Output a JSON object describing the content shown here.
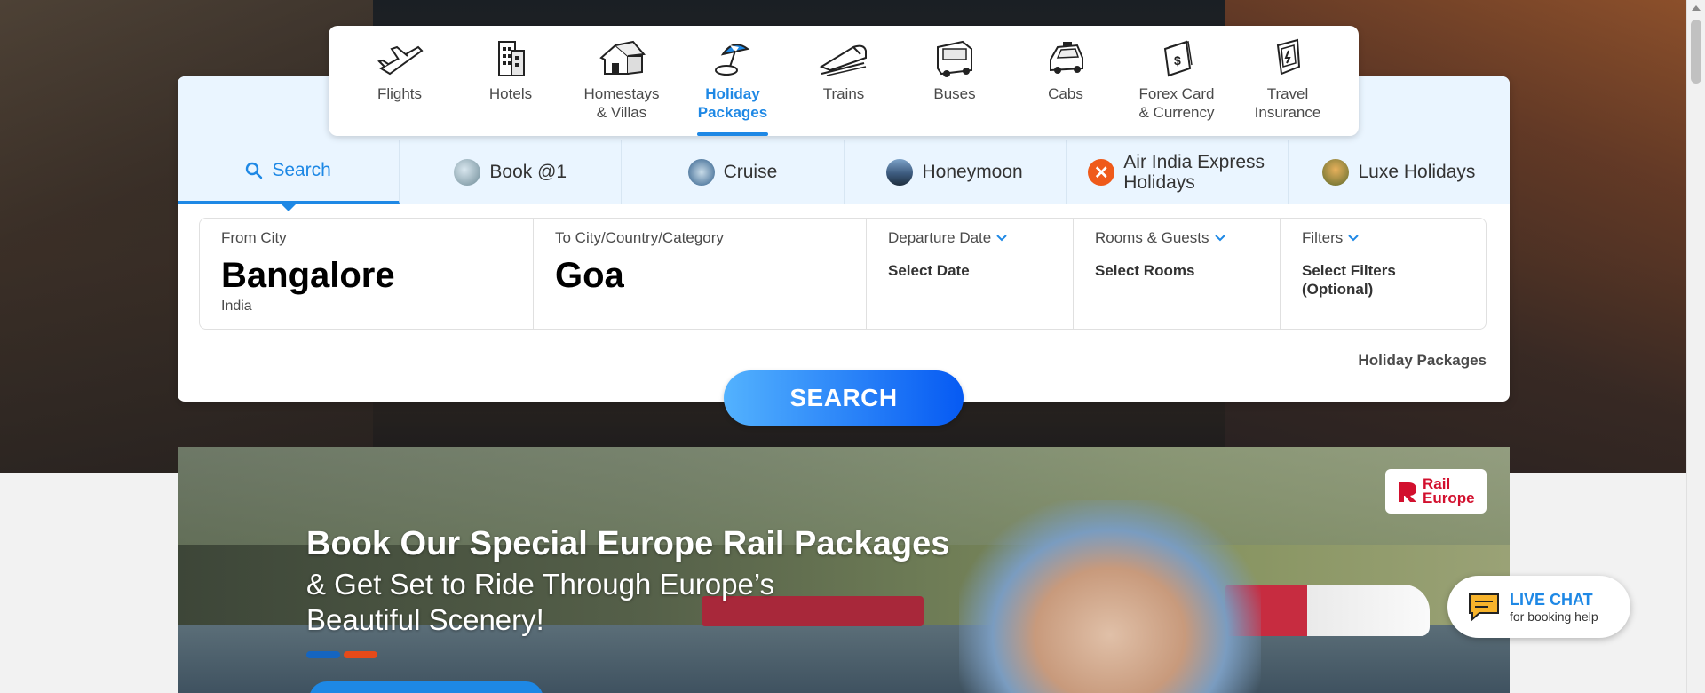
{
  "nav": {
    "items": [
      {
        "label": "Flights",
        "icon": "flight-icon"
      },
      {
        "label": "Hotels",
        "icon": "hotel-icon"
      },
      {
        "label": "Homestays\n& Villas",
        "icon": "homestay-icon"
      },
      {
        "label": "Holiday\nPackages",
        "icon": "holiday-icon"
      },
      {
        "label": "Trains",
        "icon": "train-icon"
      },
      {
        "label": "Buses",
        "icon": "bus-icon"
      },
      {
        "label": "Cabs",
        "icon": "cab-icon"
      },
      {
        "label": "Forex Card\n& Currency",
        "icon": "forex-icon"
      },
      {
        "label": "Travel\nInsurance",
        "icon": "insurance-icon"
      }
    ],
    "active": "Holiday Packages"
  },
  "tabs": {
    "search": "Search",
    "book1": "Book @1",
    "cruise": "Cruise",
    "honeymoon": "Honeymoon",
    "airindia": "Air India Express Holidays",
    "luxe": "Luxe Holidays"
  },
  "form": {
    "from_label": "From City",
    "from_value": "Bangalore",
    "from_sub": "India",
    "to_label": "To City/Country/Category",
    "to_value": "Goa",
    "departure_label": "Departure Date",
    "departure_value": "Select Date",
    "rooms_label": "Rooms & Guests",
    "rooms_value": "Select Rooms",
    "filters_label": "Filters",
    "filters_value": "Select Filters (Optional)"
  },
  "holiday_link": "Holiday Packages",
  "search_button": "SEARCH",
  "banner": {
    "title": "Book Our Special Europe Rail Packages",
    "subtitle": "& Get Set to Ride Through Europe’s Beautiful Scenery!",
    "logo_text": "Rail Europe"
  },
  "live_chat": {
    "title": "LIVE CHAT",
    "subtitle": "for booking help"
  },
  "colors": {
    "accent": "#1e88e5",
    "tab_bg": "#eaf5ff",
    "banner_dot_1": "#1565c0",
    "banner_dot_2": "#e64a19"
  }
}
